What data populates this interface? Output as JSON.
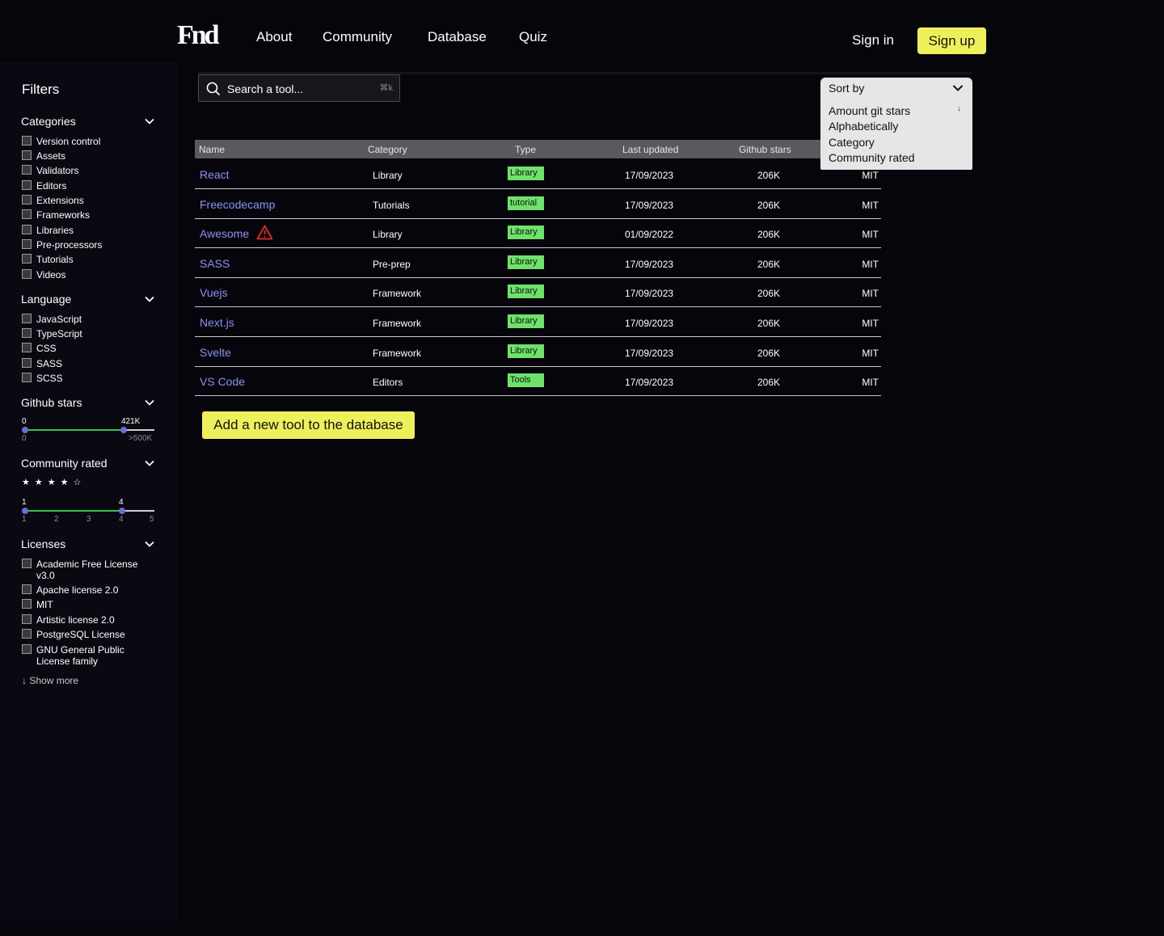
{
  "header": {
    "logo": "Fnd",
    "nav": [
      "About",
      "Community",
      "Database",
      "Quiz"
    ],
    "sign_in": "Sign in",
    "sign_up": "Sign up"
  },
  "sidebar": {
    "title": "Filters",
    "categories": {
      "title": "Categories",
      "items": [
        "Version control",
        "Assets",
        "Validators",
        "Editors",
        "Extensions",
        "Frameworks",
        "Libraries",
        "Pre-processors",
        "Tutorials",
        "Videos"
      ]
    },
    "language": {
      "title": "Language",
      "items": [
        "JavaScript",
        "TypeScript",
        "CSS",
        "SASS",
        "SCSS"
      ]
    },
    "github_stars": {
      "title": "Github stars",
      "min_value": "0",
      "max_value": "421K",
      "range_min": "0",
      "range_max": ">500K",
      "selected_fraction": 0.79
    },
    "community_rated": {
      "title": "Community rated",
      "stars": "★★★★☆",
      "rating": 4,
      "min_value": "1",
      "max_value": "4",
      "ticks": [
        "1",
        "2",
        "3",
        "4",
        "5"
      ]
    },
    "licenses": {
      "title": "Licenses",
      "items": [
        "Academic Free License v3.0",
        "Apache license 2.0",
        "MIT",
        "Artistic license 2.0",
        "PostgreSQL License",
        "GNU General Public License family"
      ],
      "show_more": "Show more"
    }
  },
  "main": {
    "search": {
      "placeholder": "Search a tool...",
      "shortcut": "⌘k"
    },
    "table": {
      "headers": [
        "Name",
        "Category",
        "Type",
        "Last updated",
        "Github stars"
      ],
      "rows": [
        {
          "name": "React",
          "category": "Library",
          "type": "Library",
          "updated": "17/09/2023",
          "stars": "206K",
          "license": "MIT"
        },
        {
          "name": "Freecodecamp",
          "category": "Tutorials",
          "type": "tutorial",
          "updated": "17/09/2023",
          "stars": "206K",
          "license": "MIT"
        },
        {
          "name": "Awesome",
          "category": "Library",
          "type": "Library",
          "updated": "01/09/2022",
          "stars": "206K",
          "license": "MIT",
          "warning": true
        },
        {
          "name": "SASS",
          "category": "Pre-prep",
          "type": "Library",
          "updated": "17/09/2023",
          "stars": "206K",
          "license": "MIT"
        },
        {
          "name": "Vuejs",
          "category": "Framework",
          "type": "Library",
          "updated": "17/09/2023",
          "stars": "206K",
          "license": "MIT"
        },
        {
          "name": "Next.js",
          "category": "Framework",
          "type": "Library",
          "updated": "17/09/2023",
          "stars": "206K",
          "license": "MIT"
        },
        {
          "name": "Svelte",
          "category": "Framework",
          "type": "Library",
          "updated": "17/09/2023",
          "stars": "206K",
          "license": "MIT"
        },
        {
          "name": "VS Code",
          "category": "Editors",
          "type": "Tools",
          "updated": "17/09/2023",
          "stars": "206K",
          "license": "MIT"
        }
      ]
    },
    "add_button": "Add a new tool to the database",
    "sort": {
      "label": "Sort by",
      "arrow": "↓",
      "options": [
        "Amount git stars",
        "Alphabetically",
        "Category",
        "Community rated"
      ]
    }
  },
  "colors": {
    "background": "#07050c",
    "accent_yellow": "#eef05b",
    "link_blue": "#8a92f2",
    "badge_green": "#6ee26a",
    "slider_green": "#38c24a",
    "knob_purple": "#6d6bd8",
    "warning_red": "#e02a2a"
  },
  "icons": [
    "search-icon",
    "chevron-down-icon",
    "warning-icon",
    "arrow-down-icon",
    "star-icon"
  ]
}
